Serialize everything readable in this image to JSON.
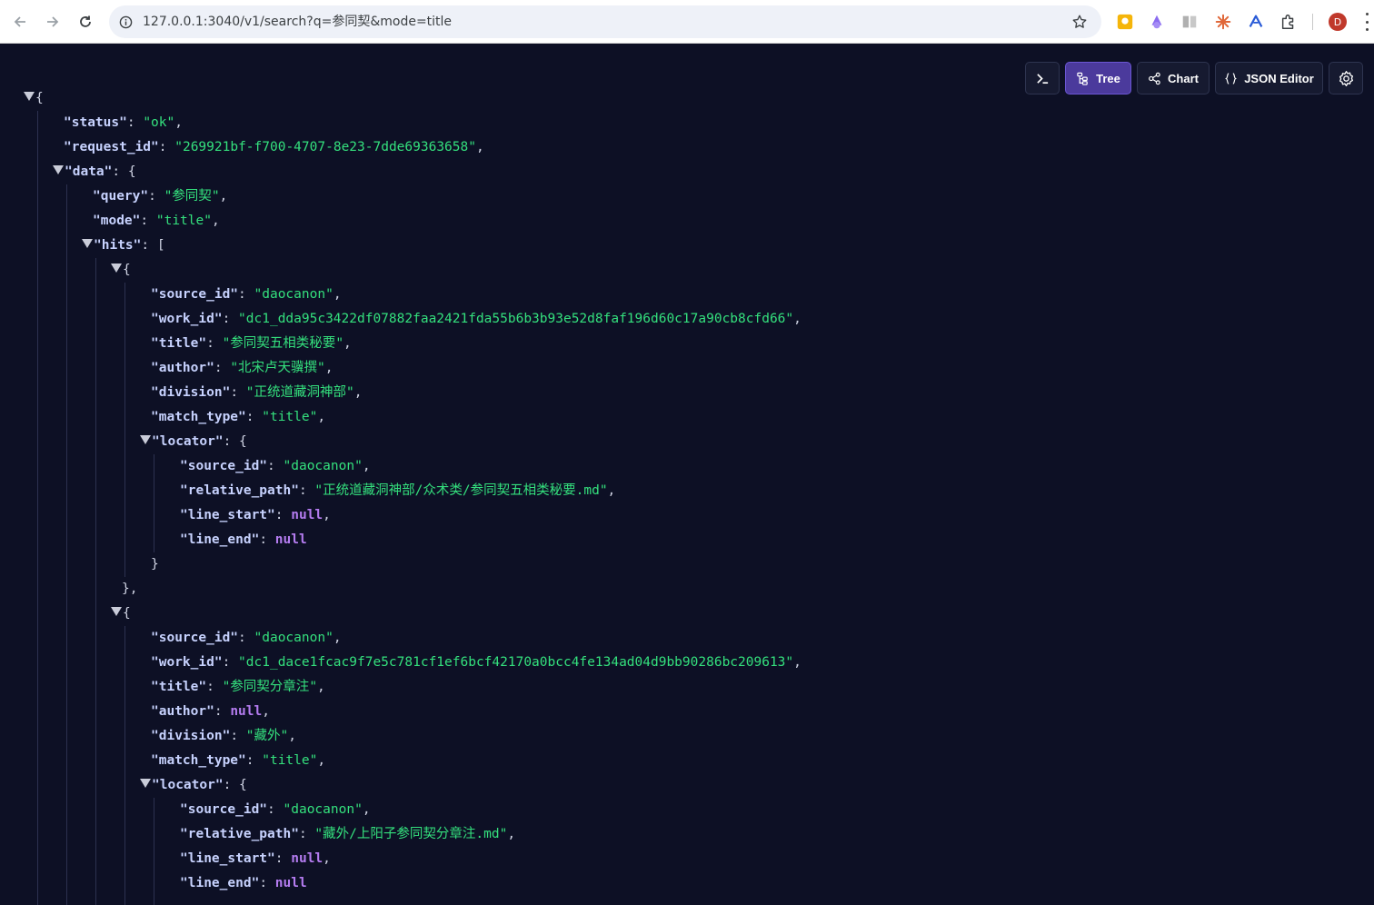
{
  "browser": {
    "url": "127.0.0.1:3040/v1/search?q=参同契&mode=title",
    "avatar_letter": "D"
  },
  "toolbar": {
    "terminal_label": "",
    "tree_label": "Tree",
    "chart_label": "Chart",
    "json_editor_label": "JSON Editor"
  },
  "colors": {
    "background": "#0d1025",
    "key": "#c7d2fe",
    "string": "#34e07d",
    "null": "#b47cf0",
    "active_tab": "#4b3a9c"
  },
  "json": {
    "status": "ok",
    "request_id": "269921bf-f700-4707-8e23-7dde69363658",
    "query": "参同契",
    "mode": "title",
    "hits": [
      {
        "source_id": "daocanon",
        "work_id": "dc1_dda95c3422df07882faa2421fda55b6b3b93e52d8faf196d60c17a90cb8cfd66",
        "title": "参同契五相类秘要",
        "author": "北宋卢天骥撰",
        "division": "正统道藏洞神部",
        "match_type": "title",
        "locator_source_id": "daocanon",
        "relative_path": "正统道藏洞神部/众术类/参同契五相类秘要.md",
        "line_start": "null",
        "line_end": "null"
      },
      {
        "source_id": "daocanon",
        "work_id": "dc1_dace1fcac9f7e5c781cf1ef6bcf42170a0bcc4fe134ad04d9bb90286bc209613",
        "title": "参同契分章注",
        "author": "null",
        "division": "藏外",
        "match_type": "title",
        "locator_source_id": "daocanon",
        "relative_path": "藏外/上阳子参同契分章注.md",
        "line_start": "null",
        "line_end": "null"
      }
    ]
  }
}
